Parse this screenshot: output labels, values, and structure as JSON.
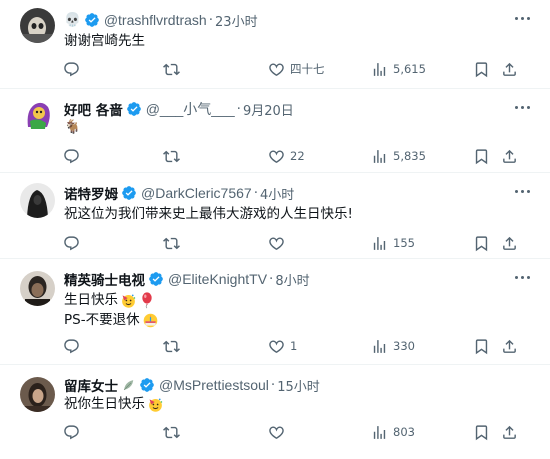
{
  "tweets": [
    {
      "name": "💀",
      "handle": "@trashflvrdtrash",
      "time": "23小时",
      "lines": [
        "谢谢宫崎先生"
      ],
      "reply_count": "",
      "retweet_count": "",
      "like_count": "四十七",
      "view_count": "5,615",
      "avatar_color": "#3a3a3a"
    },
    {
      "name": "好吧 各啬",
      "handle": "@___小气___",
      "time": "9月20日",
      "lines": [
        "🐐"
      ],
      "reply_count": "",
      "retweet_count": "",
      "like_count": "22",
      "view_count": "5,835",
      "avatar_color": "#8a3fb3"
    },
    {
      "name": "诺特罗姆",
      "handle": "@DarkCleric7567",
      "time": "4小时",
      "lines": [
        "祝这位为我们带来史上最伟大游戏的人生日快乐!"
      ],
      "reply_count": "",
      "retweet_count": "",
      "like_count": "",
      "view_count": "155",
      "avatar_color": "#1d1d1d"
    },
    {
      "name": "精英骑士电视",
      "handle": "@EliteKnightTV",
      "time": "8小时",
      "lines": [
        "生日快乐",
        "PS-不要退休"
      ],
      "reply_count": "",
      "retweet_count": "",
      "like_count": "1",
      "view_count": "330",
      "avatar_color": "#2b2622"
    },
    {
      "name": "留库女士",
      "handle": "@MsPrettiestsoul",
      "time": "15小时",
      "lines": [
        "祝你生日快乐"
      ],
      "reply_count": "",
      "retweet_count": "",
      "like_count": "",
      "view_count": "803",
      "avatar_color": "#4a3a30"
    }
  ],
  "dot_separator": "·",
  "verified_color": "#1d9bf0",
  "icon_color": "#536471"
}
